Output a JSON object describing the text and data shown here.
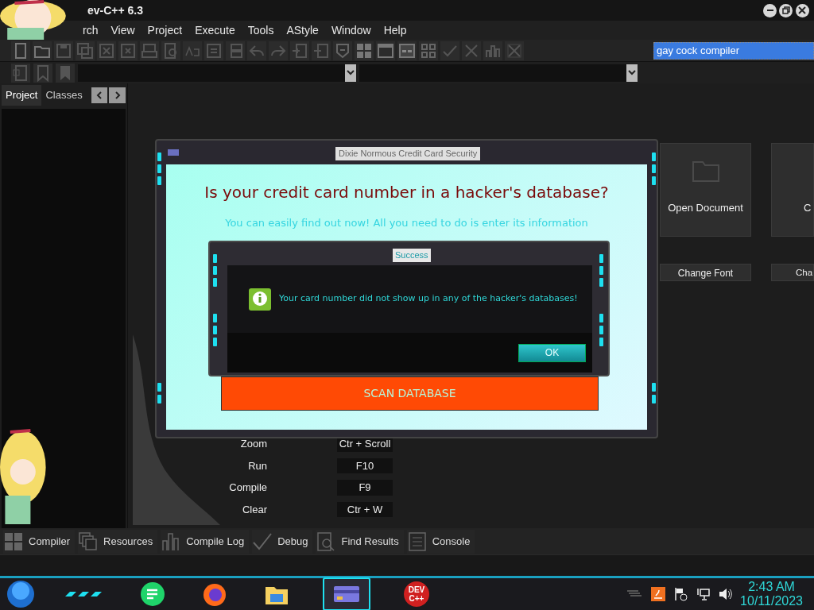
{
  "window": {
    "title": "ev-C++ 6.3"
  },
  "menu": [
    "rch",
    "View",
    "Project",
    "Execute",
    "Tools",
    "AStyle",
    "Window",
    "Help"
  ],
  "search": {
    "value": "gay cock compiler"
  },
  "side_tabs": [
    {
      "label": "Project",
      "selected": true
    },
    {
      "label": "Classes",
      "selected": false
    }
  ],
  "welcome": {
    "cards": [
      "Open Document",
      "C"
    ],
    "buttons": [
      "Change Font",
      "Cha"
    ],
    "shortcuts": [
      {
        "action": "Zoom",
        "key": "Ctr + Scroll"
      },
      {
        "action": "Run",
        "key": "F10"
      },
      {
        "action": "Compile",
        "key": "F9"
      },
      {
        "action": "Clear",
        "key": "Ctr + W"
      }
    ]
  },
  "bottom_tabs": [
    "Compiler",
    "Resources",
    "Compile Log",
    "Debug",
    "Find Results",
    "Console"
  ],
  "dialog": {
    "title": "Dixie Normous Credit Card Security",
    "heading": "Is your credit card number in a hacker's database?",
    "subheading": "You can easily find out now! All you need to do is enter its information",
    "scan_button": "SCAN DATABASE"
  },
  "message_box": {
    "title": "Success",
    "message": "Your card number did not show up in any of the hacker's databases!",
    "ok_button": "OK"
  },
  "taskbar": {
    "apps": [
      {
        "selected": false
      },
      {
        "selected": false
      },
      {
        "selected": false
      },
      {
        "selected": true
      },
      {
        "selected": false,
        "label": [
          "DEV",
          "C++"
        ]
      }
    ]
  },
  "clock": {
    "time": "2:43 AM",
    "date": "10/11/2023"
  }
}
